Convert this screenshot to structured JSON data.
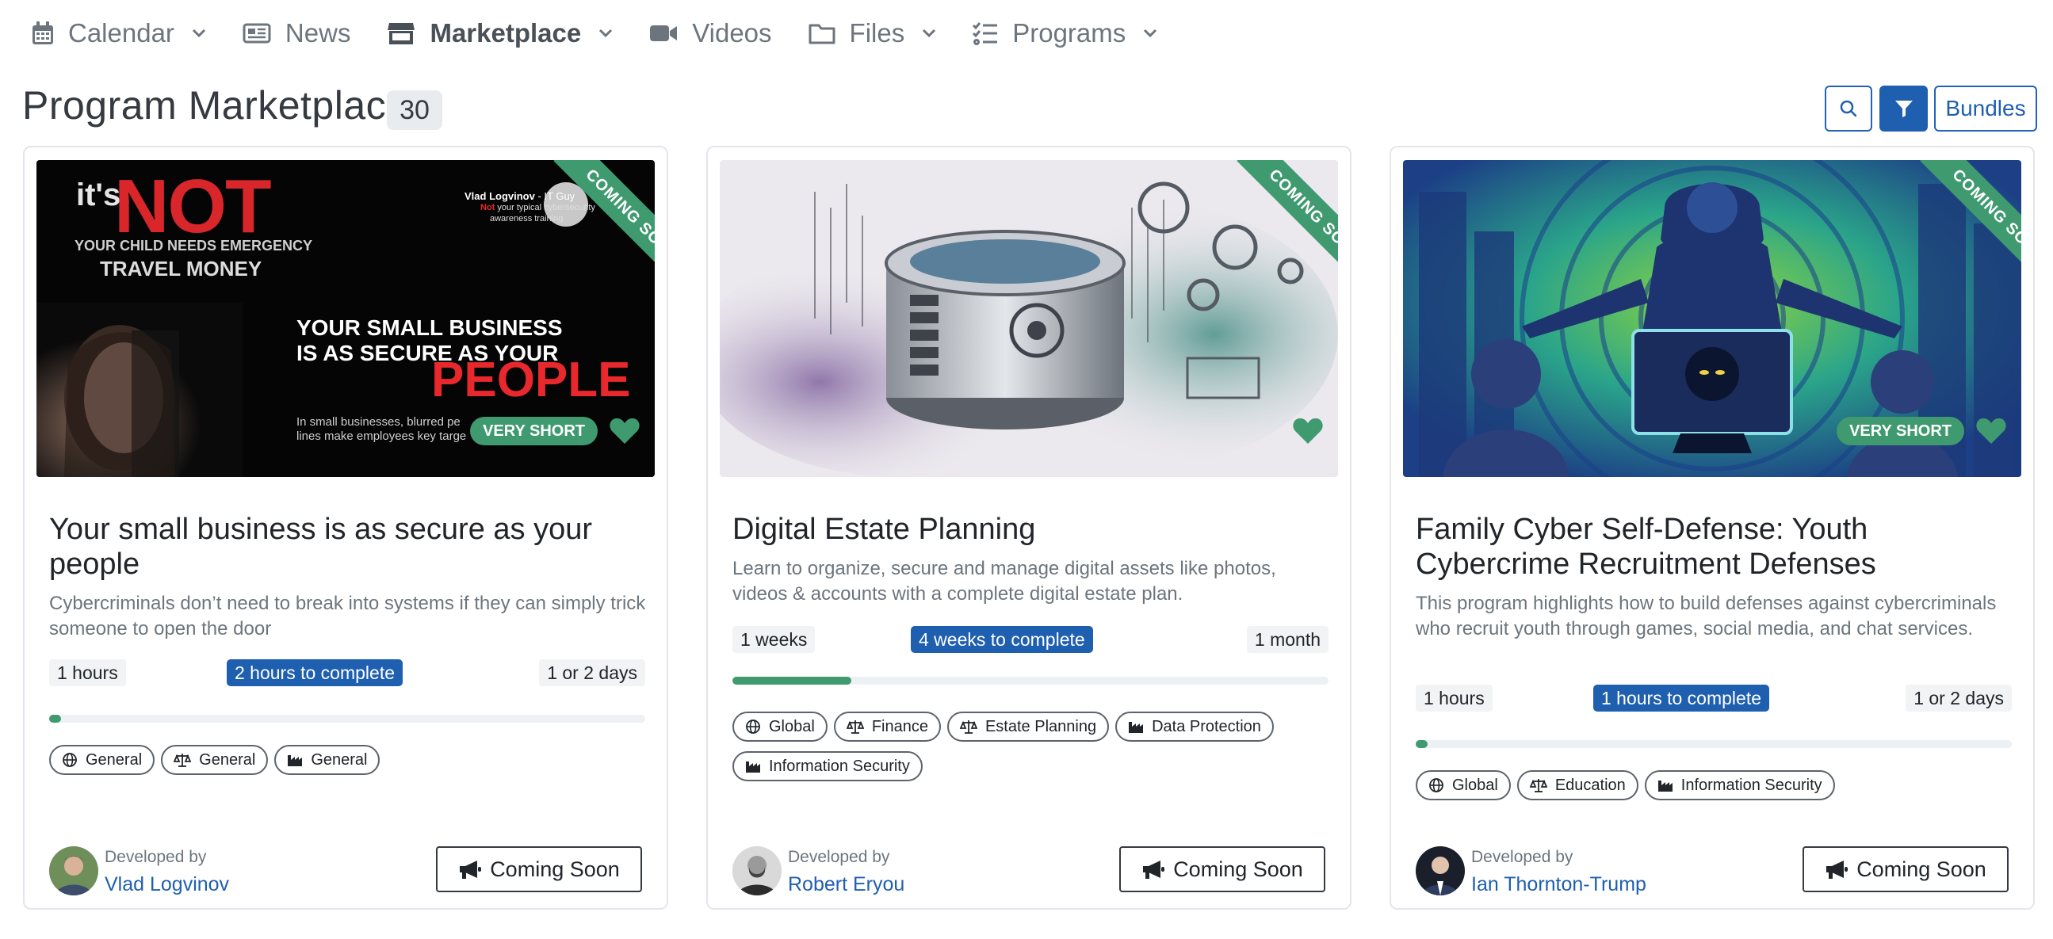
{
  "nav": {
    "items": [
      {
        "label": "Calendar",
        "icon": "calendar-icon"
      },
      {
        "label": "News",
        "icon": "newspaper-icon"
      },
      {
        "label": "Marketplace",
        "icon": "store-icon"
      },
      {
        "label": "Videos",
        "icon": "video-icon"
      },
      {
        "label": "Files",
        "icon": "folder-icon"
      },
      {
        "label": "Programs",
        "icon": "list-check-icon"
      }
    ]
  },
  "header": {
    "title": "Program Marketplace",
    "count": "30",
    "bundles_label": "Bundles"
  },
  "colors": {
    "accent_blue": "#1f5fb0",
    "accent_green": "#3f9a6f",
    "link_blue": "#1f5fb0"
  },
  "cards": [
    {
      "ribbon": "COMING SOON",
      "duration_tag": "VERY SHORT",
      "image_text": {
        "its": "it's",
        "not": "NOT",
        "child_line1": "YOUR CHILD NEEDS EMERGENCY",
        "child_line2": "TRAVEL MONEY",
        "headline_line1": "YOUR SMALL BUSINESS",
        "headline_line2": "IS AS SECURE AS YOUR",
        "headline_line3": "PEOPLE",
        "small_line1": "In small businesses, blurred pe",
        "small_line2": "lines make employees key targe",
        "author_name": "Vlad Logvinov",
        "author_tag": " - IT Guy",
        "author_sub1": "your typical cybersecurity",
        "author_sub_not": "Not",
        "author_sub2": "awareness training"
      },
      "title": "Your small business is as secure as your people",
      "description": "Cybercriminals don’t need to break into systems if they can simply trick someone to open the door",
      "time_left": "1 hours",
      "time_center": "2 hours to complete",
      "time_right": "1 or 2 days",
      "progress": 0.02,
      "chips": [
        {
          "icon": "globe-icon",
          "label": "General"
        },
        {
          "icon": "scale-icon",
          "label": "General"
        },
        {
          "icon": "industry-icon",
          "label": "General"
        }
      ],
      "developer_label": "Developed by",
      "developer_name": "Vlad Logvinov",
      "action_label": "Coming Soon"
    },
    {
      "ribbon": "COMING SOON",
      "duration_tag": "",
      "title": "Digital Estate Planning",
      "description": "Learn to organize, secure and manage digital assets like photos, videos & accounts with a complete digital estate plan.",
      "time_left": "1 weeks",
      "time_center": "4 weeks to complete",
      "time_right": "1 month",
      "progress": 0.2,
      "chips": [
        {
          "icon": "globe-icon",
          "label": "Global"
        },
        {
          "icon": "scale-icon",
          "label": "Finance"
        },
        {
          "icon": "scale-icon",
          "label": "Estate Planning"
        },
        {
          "icon": "industry-icon",
          "label": "Data Protection"
        },
        {
          "icon": "industry-icon",
          "label": "Information Security"
        }
      ],
      "developer_label": "Developed by",
      "developer_name": "Robert Eryou",
      "action_label": "Coming Soon"
    },
    {
      "ribbon": "COMING SOON",
      "duration_tag": "VERY SHORT",
      "title": "Family Cyber Self-Defense: Youth Cybercrime Recruitment Defenses",
      "description": "This program highlights how to build defenses against cybercriminals who recruit youth through games, social media, and chat services.",
      "time_left": "1 hours",
      "time_center": "1 hours to complete",
      "time_right": "1 or 2 days",
      "progress": 0.02,
      "chips": [
        {
          "icon": "globe-icon",
          "label": "Global"
        },
        {
          "icon": "scale-icon",
          "label": "Education"
        },
        {
          "icon": "industry-icon",
          "label": "Information Security"
        }
      ],
      "developer_label": "Developed by",
      "developer_name": "Ian Thornton-Trump",
      "action_label": "Coming Soon"
    }
  ]
}
